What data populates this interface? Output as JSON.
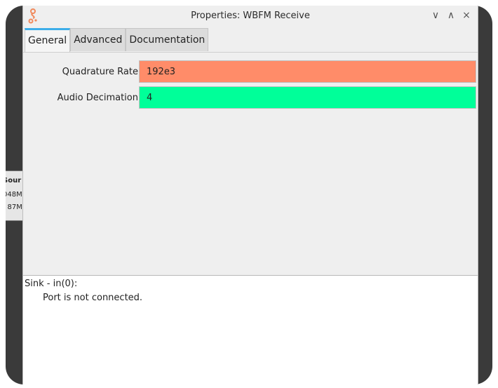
{
  "window": {
    "title": "Properties: WBFM Receive",
    "controls": {
      "minimize": "∨",
      "maximize": "∧",
      "close": "×"
    }
  },
  "background_block": {
    "line1": "Sour",
    "line2": "048M",
    "line3": ": 87M"
  },
  "tabs": [
    {
      "label": "General",
      "active": true
    },
    {
      "label": "Advanced",
      "active": false
    },
    {
      "label": "Documentation",
      "active": false
    }
  ],
  "params": [
    {
      "label": "Quadrature Rate",
      "value": "192e3",
      "color": "#ff8c69"
    },
    {
      "label": "Audio Decimation",
      "value": "4",
      "color": "#00ff99"
    }
  ],
  "info": {
    "port": "Sink - in(0):",
    "status": "Port is not connected."
  },
  "colors": {
    "accent": "#3daee9",
    "icon": "#f08a5d"
  }
}
